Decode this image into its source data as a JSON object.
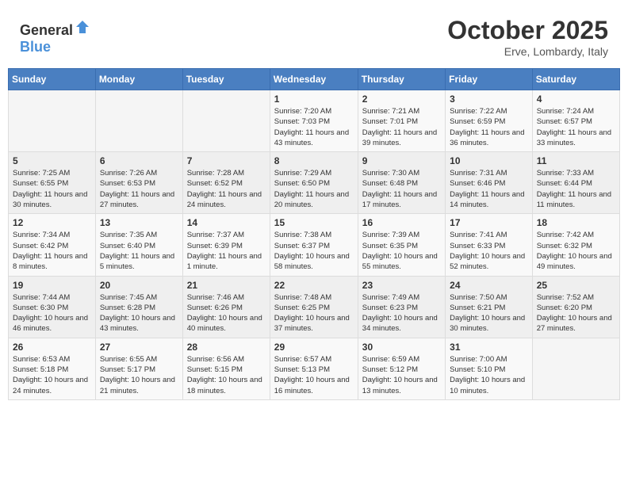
{
  "header": {
    "logo_general": "General",
    "logo_blue": "Blue",
    "month": "October 2025",
    "location": "Erve, Lombardy, Italy"
  },
  "days_of_week": [
    "Sunday",
    "Monday",
    "Tuesday",
    "Wednesday",
    "Thursday",
    "Friday",
    "Saturday"
  ],
  "weeks": [
    [
      {
        "day": "",
        "info": ""
      },
      {
        "day": "",
        "info": ""
      },
      {
        "day": "",
        "info": ""
      },
      {
        "day": "1",
        "info": "Sunrise: 7:20 AM\nSunset: 7:03 PM\nDaylight: 11 hours and 43 minutes."
      },
      {
        "day": "2",
        "info": "Sunrise: 7:21 AM\nSunset: 7:01 PM\nDaylight: 11 hours and 39 minutes."
      },
      {
        "day": "3",
        "info": "Sunrise: 7:22 AM\nSunset: 6:59 PM\nDaylight: 11 hours and 36 minutes."
      },
      {
        "day": "4",
        "info": "Sunrise: 7:24 AM\nSunset: 6:57 PM\nDaylight: 11 hours and 33 minutes."
      }
    ],
    [
      {
        "day": "5",
        "info": "Sunrise: 7:25 AM\nSunset: 6:55 PM\nDaylight: 11 hours and 30 minutes."
      },
      {
        "day": "6",
        "info": "Sunrise: 7:26 AM\nSunset: 6:53 PM\nDaylight: 11 hours and 27 minutes."
      },
      {
        "day": "7",
        "info": "Sunrise: 7:28 AM\nSunset: 6:52 PM\nDaylight: 11 hours and 24 minutes."
      },
      {
        "day": "8",
        "info": "Sunrise: 7:29 AM\nSunset: 6:50 PM\nDaylight: 11 hours and 20 minutes."
      },
      {
        "day": "9",
        "info": "Sunrise: 7:30 AM\nSunset: 6:48 PM\nDaylight: 11 hours and 17 minutes."
      },
      {
        "day": "10",
        "info": "Sunrise: 7:31 AM\nSunset: 6:46 PM\nDaylight: 11 hours and 14 minutes."
      },
      {
        "day": "11",
        "info": "Sunrise: 7:33 AM\nSunset: 6:44 PM\nDaylight: 11 hours and 11 minutes."
      }
    ],
    [
      {
        "day": "12",
        "info": "Sunrise: 7:34 AM\nSunset: 6:42 PM\nDaylight: 11 hours and 8 minutes."
      },
      {
        "day": "13",
        "info": "Sunrise: 7:35 AM\nSunset: 6:40 PM\nDaylight: 11 hours and 5 minutes."
      },
      {
        "day": "14",
        "info": "Sunrise: 7:37 AM\nSunset: 6:39 PM\nDaylight: 11 hours and 1 minute."
      },
      {
        "day": "15",
        "info": "Sunrise: 7:38 AM\nSunset: 6:37 PM\nDaylight: 10 hours and 58 minutes."
      },
      {
        "day": "16",
        "info": "Sunrise: 7:39 AM\nSunset: 6:35 PM\nDaylight: 10 hours and 55 minutes."
      },
      {
        "day": "17",
        "info": "Sunrise: 7:41 AM\nSunset: 6:33 PM\nDaylight: 10 hours and 52 minutes."
      },
      {
        "day": "18",
        "info": "Sunrise: 7:42 AM\nSunset: 6:32 PM\nDaylight: 10 hours and 49 minutes."
      }
    ],
    [
      {
        "day": "19",
        "info": "Sunrise: 7:44 AM\nSunset: 6:30 PM\nDaylight: 10 hours and 46 minutes."
      },
      {
        "day": "20",
        "info": "Sunrise: 7:45 AM\nSunset: 6:28 PM\nDaylight: 10 hours and 43 minutes."
      },
      {
        "day": "21",
        "info": "Sunrise: 7:46 AM\nSunset: 6:26 PM\nDaylight: 10 hours and 40 minutes."
      },
      {
        "day": "22",
        "info": "Sunrise: 7:48 AM\nSunset: 6:25 PM\nDaylight: 10 hours and 37 minutes."
      },
      {
        "day": "23",
        "info": "Sunrise: 7:49 AM\nSunset: 6:23 PM\nDaylight: 10 hours and 34 minutes."
      },
      {
        "day": "24",
        "info": "Sunrise: 7:50 AM\nSunset: 6:21 PM\nDaylight: 10 hours and 30 minutes."
      },
      {
        "day": "25",
        "info": "Sunrise: 7:52 AM\nSunset: 6:20 PM\nDaylight: 10 hours and 27 minutes."
      }
    ],
    [
      {
        "day": "26",
        "info": "Sunrise: 6:53 AM\nSunset: 5:18 PM\nDaylight: 10 hours and 24 minutes."
      },
      {
        "day": "27",
        "info": "Sunrise: 6:55 AM\nSunset: 5:17 PM\nDaylight: 10 hours and 21 minutes."
      },
      {
        "day": "28",
        "info": "Sunrise: 6:56 AM\nSunset: 5:15 PM\nDaylight: 10 hours and 18 minutes."
      },
      {
        "day": "29",
        "info": "Sunrise: 6:57 AM\nSunset: 5:13 PM\nDaylight: 10 hours and 16 minutes."
      },
      {
        "day": "30",
        "info": "Sunrise: 6:59 AM\nSunset: 5:12 PM\nDaylight: 10 hours and 13 minutes."
      },
      {
        "day": "31",
        "info": "Sunrise: 7:00 AM\nSunset: 5:10 PM\nDaylight: 10 hours and 10 minutes."
      },
      {
        "day": "",
        "info": ""
      }
    ]
  ]
}
